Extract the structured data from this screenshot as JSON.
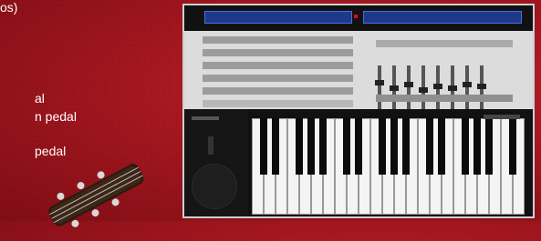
{
  "text_lines": [
    "os)",
    "al",
    "n pedal",
    "pedal"
  ],
  "images": {
    "keyboard": {
      "name": "midi-keyboard-controller-image"
    },
    "guitar": {
      "name": "acoustic-guitar-headstock-image"
    }
  },
  "colors": {
    "background": "#a3161f",
    "text": "#ffffff",
    "display": "#1d3a8a"
  }
}
